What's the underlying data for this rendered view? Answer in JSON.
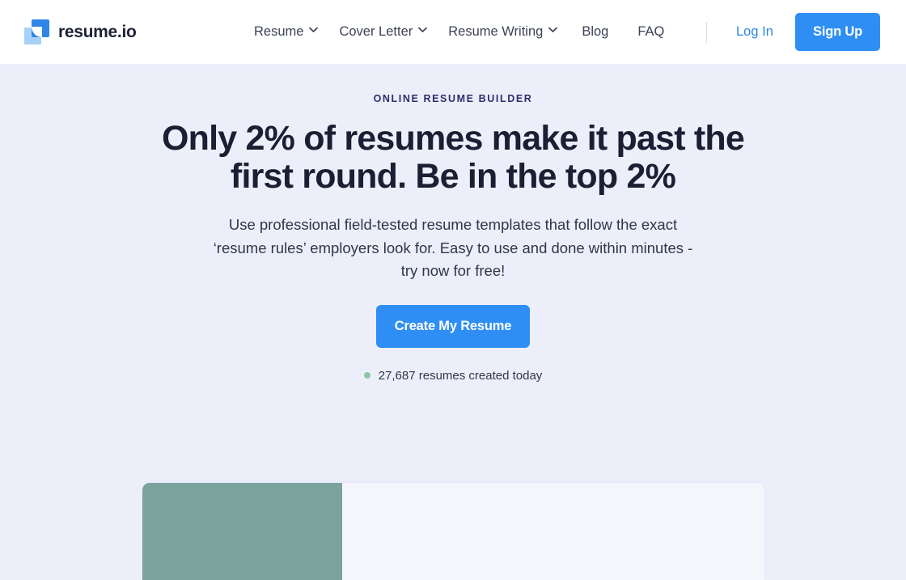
{
  "header": {
    "brand": {
      "name": "resume.io",
      "logo_icon": "resume-io-logo-icon"
    },
    "nav": [
      {
        "label": "Resume",
        "has_dropdown": true,
        "icon": "chevron-down-icon"
      },
      {
        "label": "Cover Letter",
        "has_dropdown": true,
        "icon": "chevron-down-icon"
      },
      {
        "label": "Resume Writing",
        "has_dropdown": true,
        "icon": "chevron-down-icon"
      },
      {
        "label": "Blog",
        "has_dropdown": false
      },
      {
        "label": "FAQ",
        "has_dropdown": false
      }
    ],
    "login_label": "Log In",
    "signup_label": "Sign Up"
  },
  "hero": {
    "eyebrow": "ONLINE RESUME BUILDER",
    "headline": "Only 2% of resumes make it past the first round. Be in the top 2%",
    "subhead": "Use professional field-tested resume templates that follow the exact ‘resume rules’ employers look for. Easy to use and done within minutes - try now for free!",
    "cta_label": "Create My Resume",
    "counter_text": "27,687 resumes created today",
    "counter_dot_icon": "status-dot-icon"
  },
  "preview": {
    "card_name": "resume-template-preview-card",
    "left_panel_name": "template-sidebar-preview",
    "right_panel_name": "template-body-preview"
  },
  "colors": {
    "accent_blue": "#2f8ef4",
    "link_blue": "#2f86e8",
    "page_bg": "#eceffa",
    "header_bg": "#ffffff",
    "heading_dark": "#1b1f33",
    "eyebrow_navy": "#2b2f6b",
    "counter_green": "#8ec5a7",
    "preview_teal": "#7ba39e",
    "preview_paper": "#f5f6fb"
  }
}
